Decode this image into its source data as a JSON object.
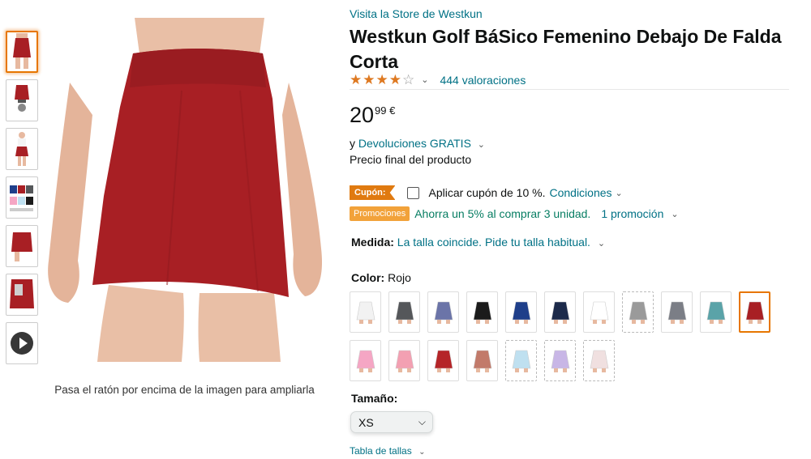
{
  "gallery": {
    "thumbnails": [
      "front-view",
      "side-view",
      "model-view",
      "color-chart",
      "detail-view",
      "pocket-view",
      "video"
    ],
    "hover_hint": "Pasa el ratón por encima de la imagen para ampliarla",
    "main_color": "#a81f24"
  },
  "product": {
    "store_link": "Visita la Store de Westkun",
    "title": "Westkun Golf BáSico Femenino Debajo De Falda Corta",
    "rating_stars": 4,
    "ratings_text": "444 valoraciones",
    "price_whole": "20",
    "price_fraction": "99 €",
    "returns_prefix": "y",
    "returns_link": "Devoluciones GRATIS",
    "final_price_text": "Precio final del producto"
  },
  "coupon": {
    "badge": "Cupón:",
    "text": "Aplicar cupón de 10 %.",
    "link": "Condiciones"
  },
  "promotion": {
    "badge": "Promociones",
    "text": "Ahorra un 5% al comprar 3 unidad.",
    "link": "1 promoción"
  },
  "size_fit": {
    "label": "Medida:",
    "text": "La talla coincide. Pide tu talla habitual."
  },
  "color": {
    "label": "Color:",
    "value": "Rojo",
    "swatches_row1": [
      "#f2f2f2",
      "#55575a",
      "#6b74a8",
      "#1b1b1b",
      "#1f3f8a",
      "#1c2a4a",
      "#ffffff",
      "#9a9a9a",
      "#7b7e86",
      "#5aa3a8",
      "#a81f24"
    ],
    "swatches_row2": [
      "#f5a6c4",
      "#f3a0b2",
      "#b52528",
      "#c27a6a",
      "#bfe0f0",
      "#c8b6e6",
      "#f0e0e0"
    ],
    "selected_index": 10
  },
  "size": {
    "label": "Tamaño:",
    "selected": "XS",
    "table_link": "Tabla de tallas"
  }
}
